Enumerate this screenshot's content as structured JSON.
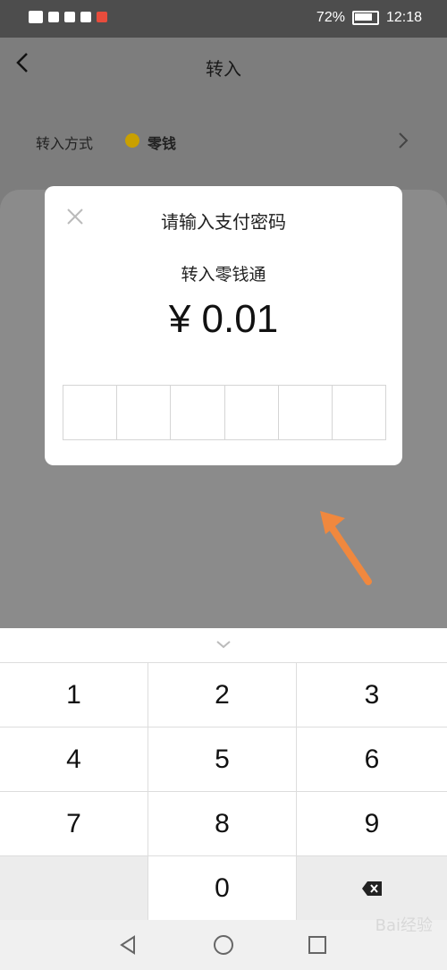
{
  "status_bar": {
    "battery": "72%",
    "time": "12:18",
    "icons": [
      "hd-icon",
      "signal-icon",
      "eye-icon",
      "mute-bell-icon",
      "map-app-icon"
    ]
  },
  "header": {
    "title": "转入",
    "back_icon": "chevron-left-icon"
  },
  "transfer_method": {
    "label": "转入方式",
    "value": "零钱",
    "icon": "coin-icon"
  },
  "dialog": {
    "title": "请输入支付密码",
    "subtitle": "转入零钱通",
    "amount": "¥ 0.01",
    "pin_length": 6
  },
  "keyboard": {
    "keys": [
      "1",
      "2",
      "3",
      "4",
      "5",
      "6",
      "7",
      "8",
      "9",
      "",
      "0",
      "delete"
    ],
    "collapse_icon": "chevron-down-icon",
    "delete_icon": "backspace-icon"
  },
  "system_nav": {
    "back_icon": "triangle-back-icon",
    "home_icon": "circle-home-icon",
    "recent_icon": "square-recent-icon"
  },
  "annotation": {
    "arrow_color": "#f0883e"
  },
  "watermark": "Bai经验"
}
